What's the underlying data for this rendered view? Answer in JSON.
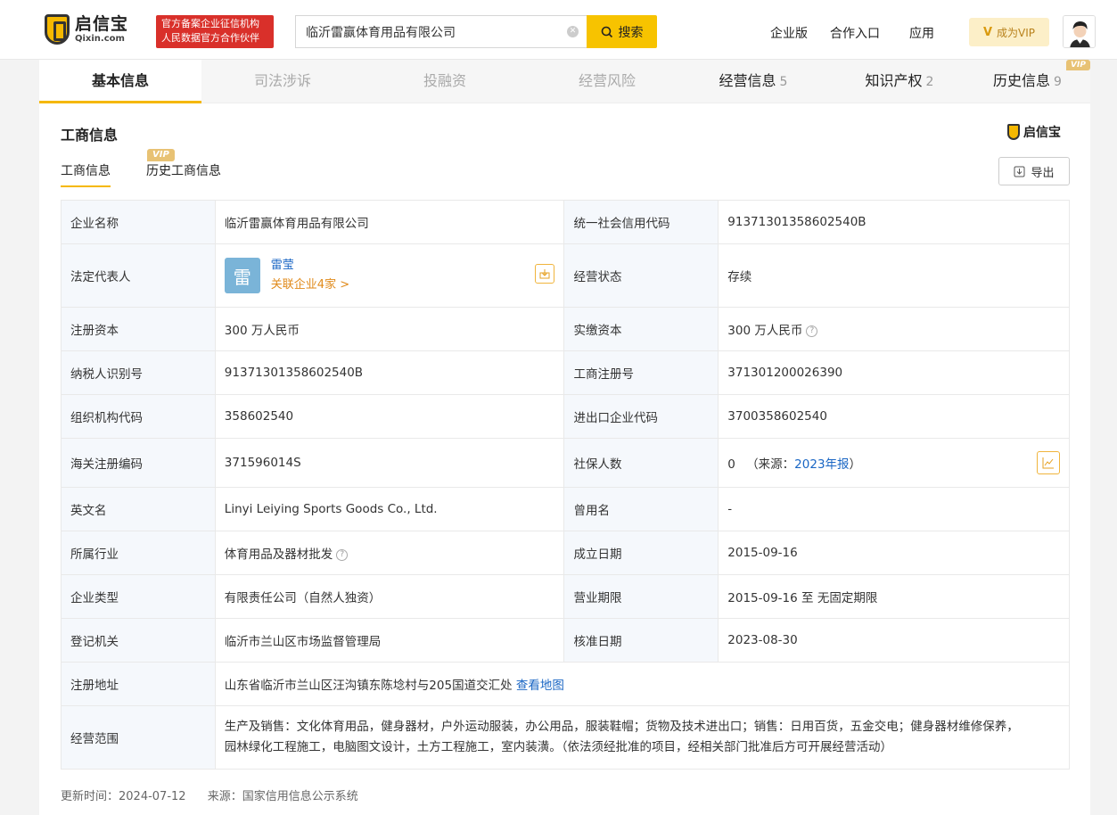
{
  "header": {
    "logo_cn": "启信宝",
    "logo_en": "Qixin.com",
    "badge_line1": "官方备案企业征信机构",
    "badge_line2": "人民数据官方合作伙伴",
    "search_value": "临沂雷赢体育用品有限公司",
    "search_button": "搜索",
    "nav": [
      "企业版",
      "合作入口",
      "应用"
    ],
    "vip_button": "成为VIP"
  },
  "tabs": [
    {
      "label": "基本信息",
      "count": ""
    },
    {
      "label": "司法涉诉",
      "count": ""
    },
    {
      "label": "投融资",
      "count": ""
    },
    {
      "label": "经营风险",
      "count": ""
    },
    {
      "label": "经营信息",
      "count": "5"
    },
    {
      "label": "知识产权",
      "count": "2"
    },
    {
      "label": "历史信息",
      "count": "9"
    }
  ],
  "vip_tag": "VIP",
  "section": {
    "title": "工商信息",
    "brand": "启信宝",
    "subtab_active": "工商信息",
    "subtab_history": "历史工商信息",
    "export": "导出"
  },
  "info": {
    "company_name_label": "企业名称",
    "company_name": "临沂雷赢体育用品有限公司",
    "credit_code_label": "统一社会信用代码",
    "credit_code": "91371301358602540B",
    "legal_rep_label": "法定代表人",
    "legal_rep_initial": "雷",
    "legal_rep_name": "雷莹",
    "legal_rep_related": "关联企业4家 >",
    "status_label": "经营状态",
    "status": "存续",
    "reg_capital_label": "注册资本",
    "reg_capital": "300 万人民币",
    "paid_capital_label": "实缴资本",
    "paid_capital": "300 万人民币",
    "taxpayer_id_label": "纳税人识别号",
    "taxpayer_id": "91371301358602540B",
    "reg_no_label": "工商注册号",
    "reg_no": "371301200026390",
    "org_code_label": "组织机构代码",
    "org_code": "358602540",
    "import_export_label": "进出口企业代码",
    "import_export": "3700358602540",
    "customs_label": "海关注册编码",
    "customs": "371596014S",
    "insured_label": "社保人数",
    "insured_count": "0",
    "insured_source_prefix": "（来源：",
    "insured_source_link": "2023年报",
    "insured_source_suffix": "）",
    "english_name_label": "英文名",
    "english_name": "Linyi Leiying Sports Goods Co., Ltd.",
    "former_name_label": "曾用名",
    "former_name": "-",
    "industry_label": "所属行业",
    "industry": "体育用品及器材批发",
    "founded_label": "成立日期",
    "founded": "2015-09-16",
    "type_label": "企业类型",
    "type": "有限责任公司（自然人独资）",
    "term_label": "营业期限",
    "term": "2015-09-16 至 无固定期限",
    "authority_label": "登记机关",
    "authority": "临沂市兰山区市场监督管理局",
    "approved_label": "核准日期",
    "approved": "2023-08-30",
    "address_label": "注册地址",
    "address": "山东省临沂市兰山区汪沟镇东陈埝村与205国道交汇处",
    "map_link": "查看地图",
    "scope_label": "经营范围",
    "scope_line1": "生产及销售：文化体育用品，健身器材，户外运动服装，办公用品，服装鞋帽；货物及技术进出口；销售：日用百货，五金交电；健身器材维修保养，",
    "scope_line2": "园林绿化工程施工，电脑图文设计，土方工程施工，室内装潢。（依法须经批准的项目，经相关部门批准后方可开展经营活动）"
  },
  "footer": {
    "updated": "更新时间：2024-07-12",
    "source": "来源：国家信用信息公示系统"
  }
}
